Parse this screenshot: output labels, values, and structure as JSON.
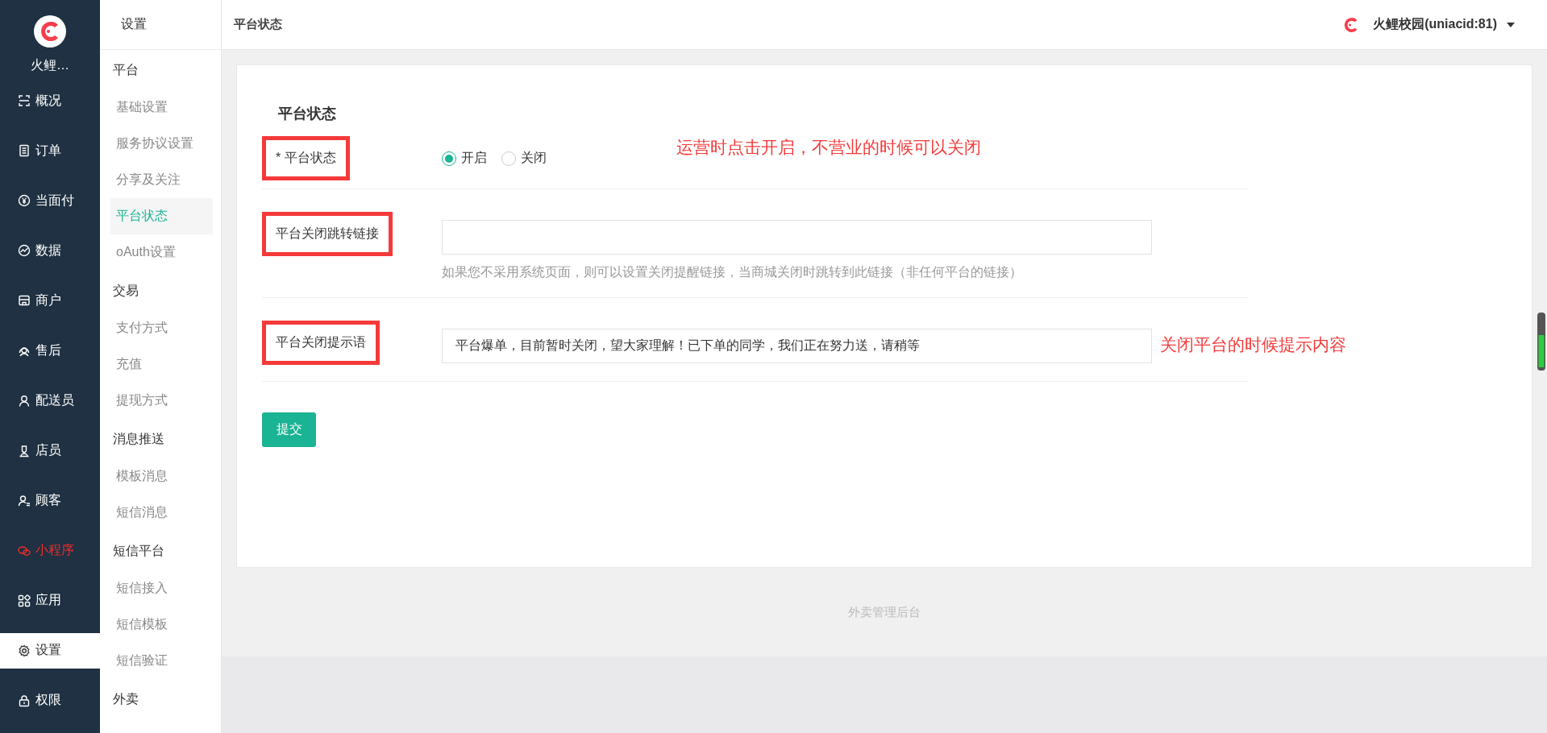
{
  "brand": {
    "name": "火鲤…"
  },
  "main_nav": [
    {
      "label": "概况",
      "selected": false,
      "highlighted": false
    },
    {
      "label": "订单",
      "selected": false,
      "highlighted": false
    },
    {
      "label": "当面付",
      "selected": false,
      "highlighted": false
    },
    {
      "label": "数据",
      "selected": false,
      "highlighted": false
    },
    {
      "label": "商户",
      "selected": false,
      "highlighted": false
    },
    {
      "label": "售后",
      "selected": false,
      "highlighted": false
    },
    {
      "label": "配送员",
      "selected": false,
      "highlighted": false
    },
    {
      "label": "店员",
      "selected": false,
      "highlighted": false
    },
    {
      "label": "顾客",
      "selected": false,
      "highlighted": false
    },
    {
      "label": "小程序",
      "selected": false,
      "highlighted": true
    },
    {
      "label": "应用",
      "selected": false,
      "highlighted": false
    },
    {
      "label": "设置",
      "selected": true,
      "highlighted": false
    },
    {
      "label": "权限",
      "selected": false,
      "highlighted": false
    }
  ],
  "sub_nav": {
    "title": "设置",
    "groups": [
      {
        "title": "平台",
        "items": [
          {
            "label": "基础设置",
            "selected": false
          },
          {
            "label": "服务协议设置",
            "selected": false
          },
          {
            "label": "分享及关注",
            "selected": false
          },
          {
            "label": "平台状态",
            "selected": true
          },
          {
            "label": "oAuth设置",
            "selected": false
          }
        ]
      },
      {
        "title": "交易",
        "items": [
          {
            "label": "支付方式",
            "selected": false
          },
          {
            "label": "充值",
            "selected": false
          },
          {
            "label": "提现方式",
            "selected": false
          }
        ]
      },
      {
        "title": "消息推送",
        "items": [
          {
            "label": "模板消息",
            "selected": false
          },
          {
            "label": "短信消息",
            "selected": false
          }
        ]
      },
      {
        "title": "短信平台",
        "items": [
          {
            "label": "短信接入",
            "selected": false
          },
          {
            "label": "短信模板",
            "selected": false
          },
          {
            "label": "短信验证",
            "selected": false
          }
        ]
      },
      {
        "title": "外卖"
      }
    ]
  },
  "top_bar": {
    "title": "平台状态",
    "account": "火鲤校园(uniacid:81)"
  },
  "form": {
    "title": "平台状态",
    "rows": [
      {
        "kind": "radio",
        "label": "* 平台状态",
        "options": [
          {
            "label": "开启",
            "selected": true
          },
          {
            "label": "关闭",
            "selected": false
          }
        ],
        "annotation": "运营时点击开启，不营业的时候可以关闭"
      },
      {
        "kind": "input",
        "label": "平台关闭跳转链接",
        "help": "如果您不采用系统页面，则可以设置关闭提醒链接，当商城关闭时跳转到此链接（非任何平台的链接）"
      },
      {
        "kind": "input",
        "label": "平台关闭提示语",
        "value": "平台爆单，目前暂时关闭，望大家理解！已下单的同学，我们正在努力送，请稍等",
        "annotation": "关闭平台的时候提示内容"
      }
    ],
    "submit": "提交"
  },
  "footer": "外卖管理后台"
}
